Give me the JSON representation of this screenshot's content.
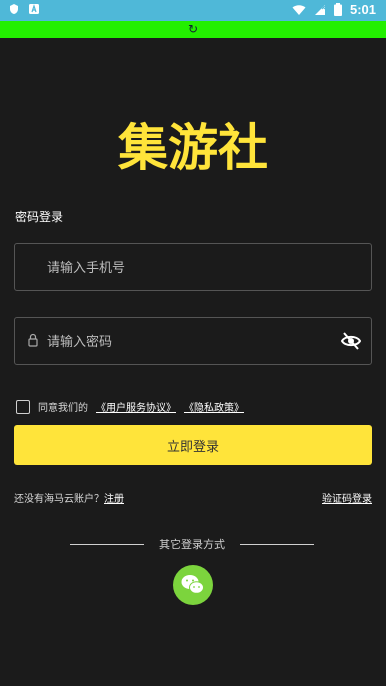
{
  "status": {
    "time": "5:01"
  },
  "brand": {
    "logo_text": "集游社",
    "accent": "#ffe43a"
  },
  "login": {
    "title": "密码登录",
    "phone_placeholder": "请输入手机号",
    "password_placeholder": "请输入密码",
    "agree_prefix": "同意我们的",
    "agree_link1": "《用户服务协议》",
    "agree_link2": "《隐私政策》",
    "login_button": "立即登录",
    "no_account_text": "还没有海马云账户？",
    "register": "注册",
    "sms_login": "验证码登录",
    "other_methods": "其它登录方式"
  },
  "icons": {
    "lock": "lock-icon",
    "eye": "eye-off-icon",
    "wechat": "wechat-icon"
  }
}
